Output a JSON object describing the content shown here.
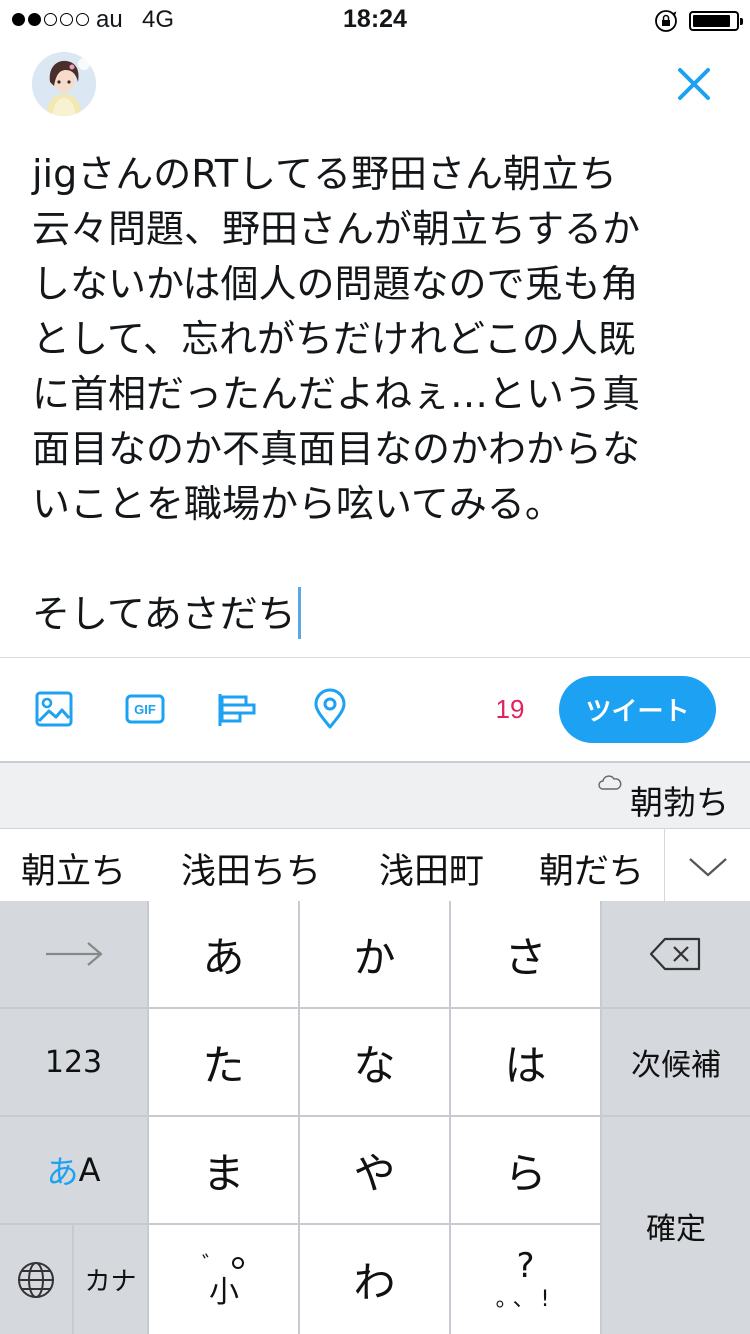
{
  "status_bar": {
    "carrier": "au",
    "network": "4G",
    "time": "18:24",
    "signal_bars_filled": 2,
    "signal_bars_total": 5,
    "battery_level": 0.8,
    "icons": [
      "orientation-lock-icon",
      "battery-icon"
    ]
  },
  "header": {
    "avatar_icon": "user-avatar",
    "close_icon": "close-icon"
  },
  "compose": {
    "text": "jigさんのRTしてる野田さん朝立ち\n云々問題、野田さんが朝立ちするか\nしないかは個人の問題なので兎も角\nとして、忘れがちだけれどこの人既\nに首相だったんだよねぇ…という真\n面目なのか不真面目なのかわからな\nいことを職場から呟いてみる。\n\nそしてあさだち"
  },
  "toolbar": {
    "icons": [
      "image-icon",
      "gif-icon",
      "poll-icon",
      "location-icon"
    ],
    "char_count": "19",
    "tweet_label": "ツイート",
    "accent_color": "#1da1f2",
    "count_color": "#e0245e"
  },
  "keyboard": {
    "cloud_prediction": "朝勃ち",
    "suggestions": [
      "朝立ち",
      "浅田ちち",
      "浅田町",
      "朝だち"
    ],
    "rows": [
      [
        "→",
        "あ",
        "か",
        "さ",
        "⌫"
      ],
      [
        "123",
        "た",
        "な",
        "は",
        "次候補"
      ],
      [
        "あA",
        "ま",
        "や",
        "ら",
        "確定"
      ],
      [
        "🌐",
        "カナ",
        "゛゜小",
        "わ",
        "、。?!"
      ]
    ],
    "labels": {
      "arrow": "",
      "num": "123",
      "a": "あ",
      "ka": "か",
      "sa": "さ",
      "ta": "た",
      "na": "な",
      "ha": "は",
      "next_candidate": "次候補",
      "mode_kana": "あ",
      "mode_alpha": "A",
      "ma": "ま",
      "ya": "や",
      "ra": "ら",
      "confirm": "確定",
      "kana": "カナ",
      "wa": "わ",
      "question": "?",
      "punct": "。、!"
    }
  }
}
